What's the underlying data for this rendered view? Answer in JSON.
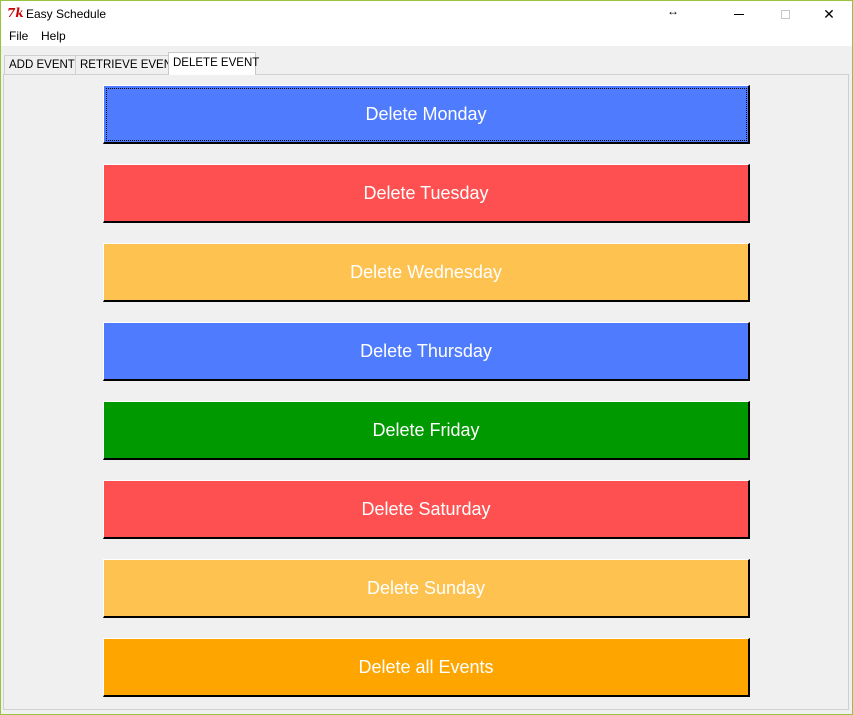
{
  "window": {
    "title": "Easy Schedule",
    "app_icon": "tk-feather-icon",
    "app_icon_glyph": "7k",
    "resize_glyph": "↔",
    "controls": {
      "minimize_icon": "minimize-icon",
      "maximize_icon": "maximize-icon",
      "close_icon": "close-icon",
      "close_glyph": "✕"
    }
  },
  "menu": {
    "file_label": "File",
    "help_label": "Help"
  },
  "tabs": [
    {
      "label": "ADD EVENT",
      "selected": false
    },
    {
      "label": "RETRIEVE EVENT",
      "selected": false
    },
    {
      "label": "DELETE EVENT",
      "selected": true
    }
  ],
  "buttons": [
    {
      "label": "Delete Monday",
      "color": "#4f7bfe",
      "focused": true
    },
    {
      "label": "Delete Tuesday",
      "color": "#fe5050",
      "focused": false
    },
    {
      "label": "Delete Wednesday",
      "color": "#fec250",
      "focused": false
    },
    {
      "label": "Delete Thursday",
      "color": "#4f7bfe",
      "focused": false
    },
    {
      "label": "Delete Friday",
      "color": "#009900",
      "focused": false
    },
    {
      "label": "Delete Saturday",
      "color": "#fe5050",
      "focused": false
    },
    {
      "label": "Delete Sunday",
      "color": "#fec250",
      "focused": false
    },
    {
      "label": "Delete all Events",
      "color": "#fea500",
      "focused": false
    }
  ]
}
